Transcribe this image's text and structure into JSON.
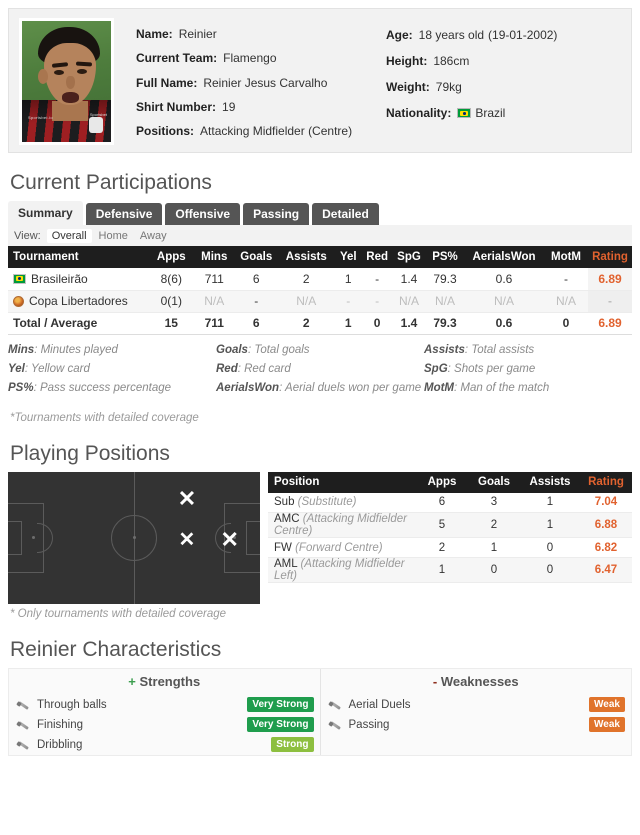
{
  "player": {
    "photo_alt": "player-photo",
    "fields_left": [
      {
        "label": "Name:",
        "value": "Reinier"
      },
      {
        "label": "Current Team:",
        "value": "Flamengo"
      },
      {
        "label": "Full Name:",
        "value": "Reinier Jesus Carvalho"
      },
      {
        "label": "Shirt Number:",
        "value": "19"
      },
      {
        "label": "Positions:",
        "value": "Attacking Midfielder (Centre)"
      }
    ],
    "fields_right": [
      {
        "label": "Age:",
        "value": "18 years old",
        "italic": "(19-01-2002)"
      },
      {
        "label": "Height:",
        "value": "186cm"
      },
      {
        "label": "Weight:",
        "value": "79kg"
      },
      {
        "label": "Nationality:",
        "value": "Brazil",
        "flag": "brazil-flag"
      }
    ]
  },
  "participations": {
    "title": "Current Participations",
    "tabs": [
      {
        "label": "Summary",
        "active": true
      },
      {
        "label": "Defensive",
        "active": false
      },
      {
        "label": "Offensive",
        "active": false
      },
      {
        "label": "Passing",
        "active": false
      },
      {
        "label": "Detailed",
        "active": false
      }
    ],
    "view": {
      "label": "View:",
      "options": [
        "Overall",
        "Home",
        "Away"
      ],
      "selected": "Overall"
    },
    "columns": [
      "Tournament",
      "Apps",
      "Mins",
      "Goals",
      "Assists",
      "Yel",
      "Red",
      "SpG",
      "PS%",
      "AerialsWon",
      "MotM",
      "Rating"
    ],
    "rows": [
      {
        "icon": "brazil-flag-icon",
        "tournament": "Brasileirão",
        "apps": "8(6)",
        "mins": "711",
        "goals": "6",
        "assists": "2",
        "yel": "1",
        "red": "-",
        "spg": "1.4",
        "ps": "79.3",
        "aerials_won": "0.6",
        "motm": "-",
        "rating": "6.89"
      },
      {
        "icon": "copa-libertadores-icon",
        "tournament": "Copa Libertadores",
        "apps": "0(1)",
        "mins": "N/A",
        "goals": "-",
        "assists": "N/A",
        "yel": "-",
        "red": "-",
        "spg": "N/A",
        "ps": "N/A",
        "aerials_won": "N/A",
        "motm": "N/A",
        "rating": "-"
      }
    ],
    "total": {
      "tournament": "Total / Average",
      "apps": "15",
      "mins": "711",
      "goals": "6",
      "assists": "2",
      "yel": "1",
      "red": "0",
      "spg": "1.4",
      "ps": "79.3",
      "aerials_won": "0.6",
      "motm": "0",
      "rating": "6.89"
    },
    "legend": [
      {
        "key": "Mins",
        "desc": "Minutes played"
      },
      {
        "key": "Goals",
        "desc": "Total goals"
      },
      {
        "key": "Assists",
        "desc": "Total assists"
      },
      {
        "key": "Yel",
        "desc": "Yellow card"
      },
      {
        "key": "Red",
        "desc": "Red card"
      },
      {
        "key": "SpG",
        "desc": "Shots per game"
      },
      {
        "key": "PS%",
        "desc": "Pass success percentage"
      },
      {
        "key": "AerialsWon",
        "desc": "Aerial duels won per game"
      },
      {
        "key": "MotM",
        "desc": "Man of the match"
      }
    ],
    "footnote": "*Tournaments with detailed coverage"
  },
  "playing_positions": {
    "title": "Playing Positions",
    "pitch_markers": [
      {
        "name": "aml-marker",
        "left_pct": 71,
        "top_pct": 21
      },
      {
        "name": "amc-marker",
        "left_pct": 71,
        "top_pct": 52
      },
      {
        "name": "fw-marker",
        "left_pct": 88,
        "top_pct": 52
      }
    ],
    "columns": [
      "Position",
      "Apps",
      "Goals",
      "Assists",
      "Rating"
    ],
    "rows": [
      {
        "code": "Sub",
        "desc": "(Substitute)",
        "apps": "6",
        "goals": "3",
        "assists": "1",
        "rating": "7.04"
      },
      {
        "code": "AMC",
        "desc": "(Attacking Midfielder Centre)",
        "apps": "5",
        "goals": "2",
        "assists": "1",
        "rating": "6.88"
      },
      {
        "code": "FW",
        "desc": "(Forward Centre)",
        "apps": "2",
        "goals": "1",
        "assists": "0",
        "rating": "6.82"
      },
      {
        "code": "AML",
        "desc": "(Attacking Midfielder Left)",
        "apps": "1",
        "goals": "0",
        "assists": "0",
        "rating": "6.47"
      }
    ],
    "footnote": "* Only tournaments with detailed coverage"
  },
  "characteristics": {
    "title": "Reinier Characteristics",
    "strengths_head_sign": "+",
    "strengths_head": "Strengths",
    "weaknesses_head_sign": "-",
    "weaknesses_head": "Weaknesses",
    "strengths": [
      {
        "name": "Through balls",
        "badge": "Very Strong",
        "level": "verystrong"
      },
      {
        "name": "Finishing",
        "badge": "Very Strong",
        "level": "verystrong"
      },
      {
        "name": "Dribbling",
        "badge": "Strong",
        "level": "strong"
      }
    ],
    "weaknesses": [
      {
        "name": "Aerial Duels",
        "badge": "Weak",
        "level": "weak"
      },
      {
        "name": "Passing",
        "badge": "Weak",
        "level": "weak"
      }
    ]
  },
  "colors": {
    "rating_orange": "#e1622f",
    "header_black": "#1e1e1e",
    "very_strong_green": "#1f9d4d",
    "strong_green": "#8dbf3f",
    "weak_orange": "#e0732b",
    "pitch_dark": "#333333"
  }
}
